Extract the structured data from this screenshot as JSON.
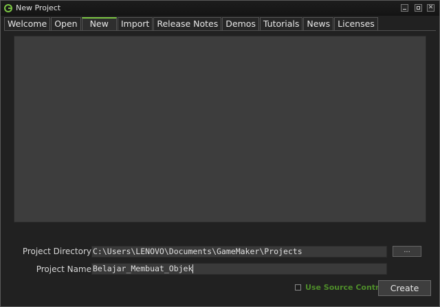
{
  "window": {
    "title": "New Project",
    "app_icon": "gamemaker-logo-icon",
    "controls": {
      "minimize": "minimize-icon",
      "maximize": "maximize-icon",
      "close": "✕"
    }
  },
  "tabs": [
    {
      "label": "Welcome"
    },
    {
      "label": "Open"
    },
    {
      "label": "New",
      "active": true
    },
    {
      "label": "Import"
    },
    {
      "label": "Release Notes"
    },
    {
      "label": "Demos"
    },
    {
      "label": "Tutorials"
    },
    {
      "label": "News"
    },
    {
      "label": "Licenses"
    }
  ],
  "form": {
    "directory_label": "Project Directory",
    "directory_value": "C:\\Users\\LENOVO\\Documents\\GameMaker\\Projects",
    "browse_label": "...",
    "name_label": "Project Name",
    "name_value": "Belajar_Membuat_Objek",
    "source_control_label": "Use Source Control",
    "source_control_checked": false,
    "create_label": "Create"
  },
  "colors": {
    "accent_green": "#7cc644",
    "source_control_text": "#4e8d2a",
    "preview_background": "#3d3d3d"
  }
}
